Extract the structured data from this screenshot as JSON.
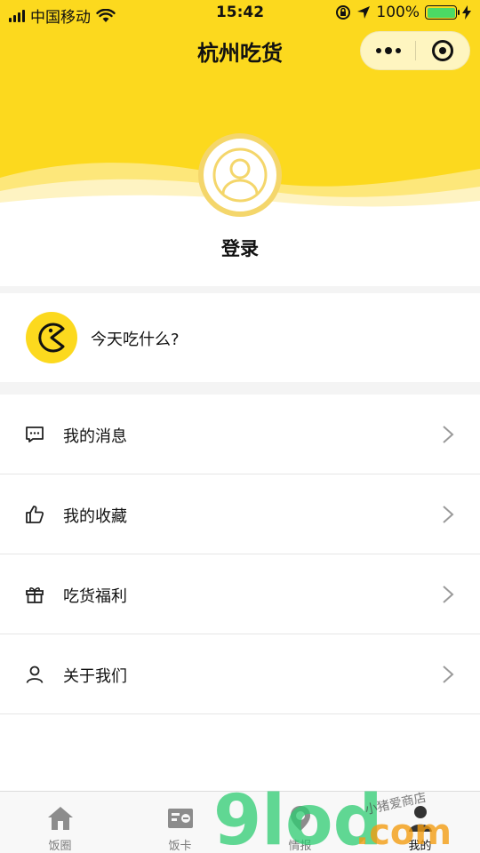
{
  "status_bar": {
    "carrier": "中国移动",
    "time": "15:42",
    "battery": "100%"
  },
  "nav": {
    "title": "杭州吃货"
  },
  "profile": {
    "login_label": "登录"
  },
  "feature": {
    "label": "今天吃什么?"
  },
  "menu": {
    "items": [
      {
        "label": "我的消息",
        "icon": "chat-icon"
      },
      {
        "label": "我的收藏",
        "icon": "thumbs-up-icon"
      },
      {
        "label": "吃货福利",
        "icon": "gift-icon"
      },
      {
        "label": "关于我们",
        "icon": "person-icon"
      }
    ]
  },
  "tabbar": {
    "tabs": [
      {
        "label": "饭圈",
        "icon": "home-icon",
        "active": false
      },
      {
        "label": "饭卡",
        "icon": "card-icon",
        "active": false
      },
      {
        "label": "情报",
        "icon": "location-icon",
        "active": false
      },
      {
        "label": "我的",
        "icon": "user-icon",
        "active": true
      }
    ]
  },
  "watermark": {
    "text": "9lod.com",
    "subtext": "小猪爱商店"
  },
  "colors": {
    "brand_yellow": "#fcd91e",
    "avatar_ring": "#f4d66b",
    "battery_green": "#4cd964"
  }
}
